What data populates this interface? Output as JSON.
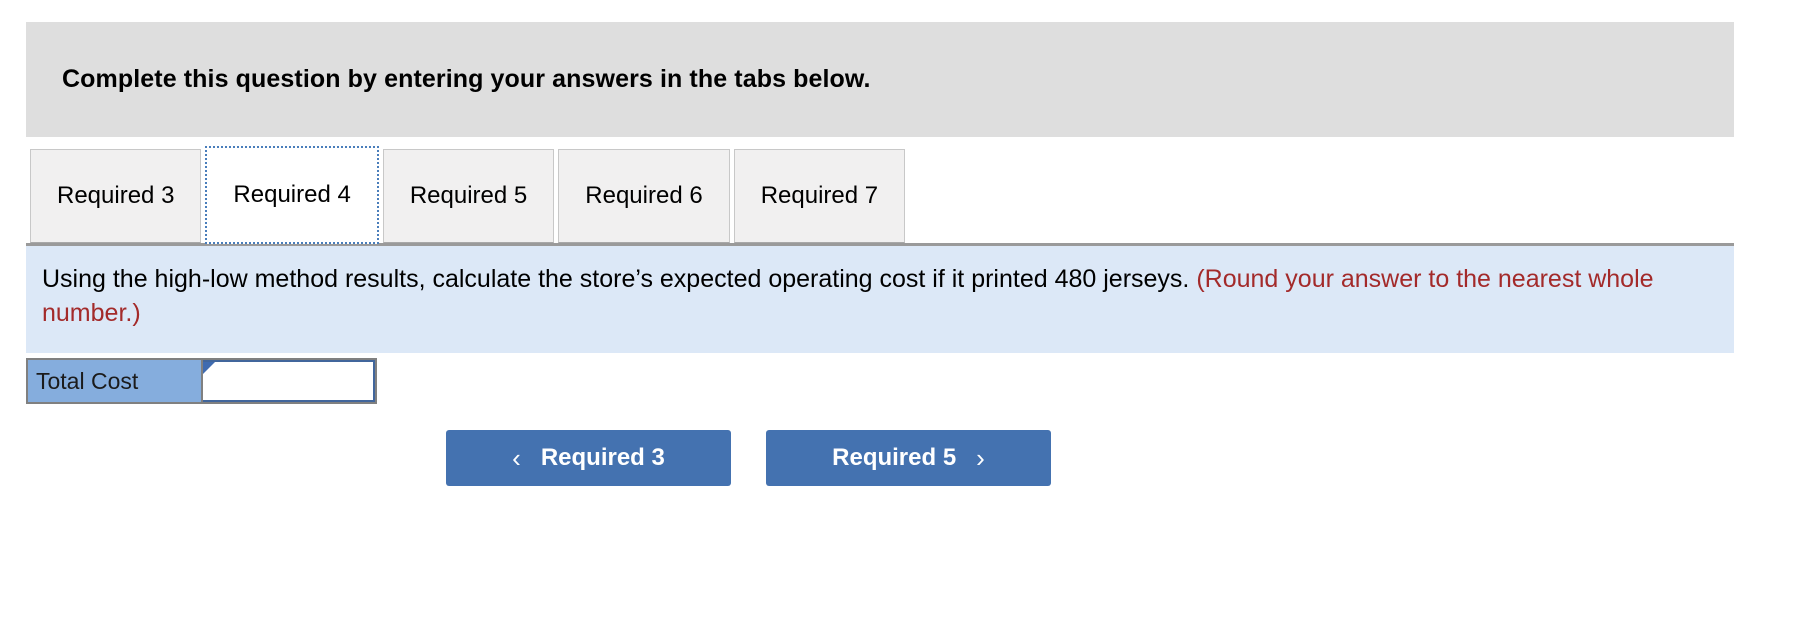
{
  "header": {
    "instruction": "Complete this question by entering your answers in the tabs below."
  },
  "tabs": {
    "items": [
      {
        "label": "Required 3",
        "active": false
      },
      {
        "label": "Required 4",
        "active": true
      },
      {
        "label": "Required 5",
        "active": false
      },
      {
        "label": "Required 6",
        "active": false
      },
      {
        "label": "Required 7",
        "active": false
      }
    ]
  },
  "question": {
    "prompt": "Using the high-low method results, calculate the store’s expected operating cost if it printed 480 jerseys.",
    "note": "(Round your answer to the nearest whole number.)"
  },
  "answer_table": {
    "row_label": "Total Cost",
    "input_value": "",
    "input_placeholder": ""
  },
  "navigation": {
    "prev_label": "Required 3",
    "prev_icon": "chevron-left-icon",
    "prev_glyph": "‹",
    "next_label": "Required 5",
    "next_icon": "chevron-right-icon",
    "next_glyph": "›"
  },
  "colors": {
    "header_bg": "#dedede",
    "question_bg": "#dce8f7",
    "note_red": "#a32a2a",
    "button_blue": "#4472b0",
    "label_blue": "#85addd",
    "tab_inactive_bg": "#f1f0f0",
    "focus_outline": "#4a7ebb"
  }
}
